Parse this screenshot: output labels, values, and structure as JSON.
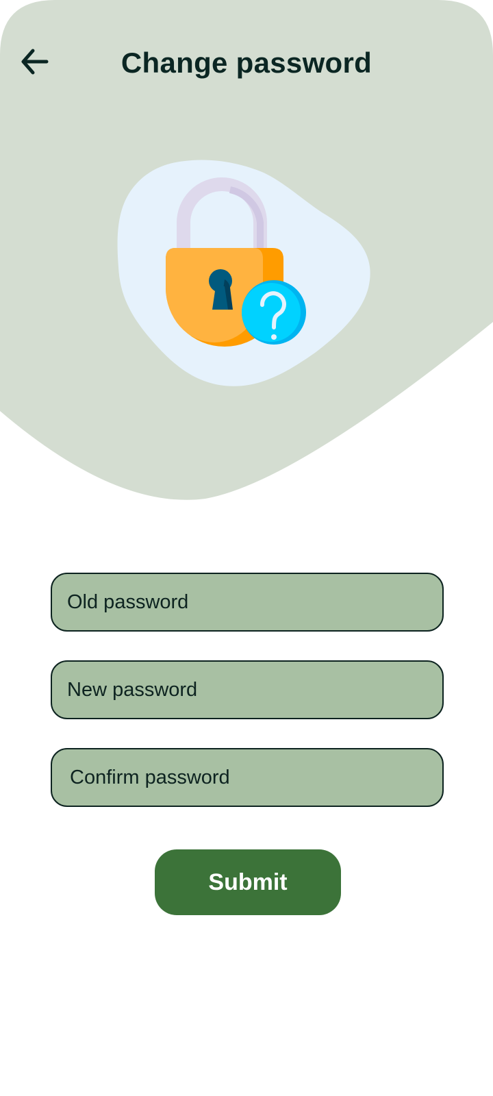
{
  "header": {
    "title": "Change password",
    "back_icon": "arrow-left-icon"
  },
  "illustration": {
    "icons": [
      "padlock-icon",
      "question-mark-icon"
    ]
  },
  "form": {
    "old_password_placeholder": "Old password",
    "new_password_placeholder": "New password",
    "confirm_password_placeholder": "Confirm password",
    "submit_label": "Submit"
  },
  "colors": {
    "background_shape": "#d4ddd1",
    "blob": "#e6f2fc",
    "field_fill": "#a8c0a3",
    "field_border": "#0d2320",
    "submit_button": "#3c7339",
    "title_text": "#0b2623"
  }
}
